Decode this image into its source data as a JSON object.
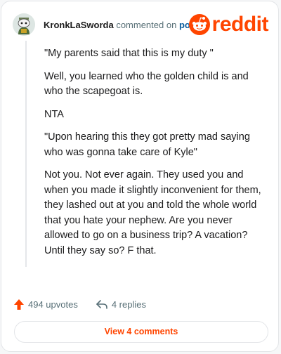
{
  "comment": {
    "username": "KronkLaSworda",
    "action_text": "commented on",
    "post_link": "post",
    "brand": "reddit",
    "brand_color": "#ff4500",
    "paragraphs": [
      "\"My parents said that this is my duty \"",
      "Well, you learned who the golden child is and who the scapegoat is.",
      "NTA",
      "\"Upon hearing this they got pretty mad saying who was gonna take care of Kyle\"",
      "Not you. Not ever again. They used you and when you made it slightly inconvenient for them, they lashed out at you and told the whole world that you hate your nephew. Are you never allowed to go on a business trip? A vacation? Until they say so? F that."
    ]
  },
  "footer": {
    "upvotes_label": "494 upvotes",
    "replies_label": "4 replies",
    "view_comments_label": "View 4 comments"
  },
  "icons": {
    "avatar": "snoo-avatar-icon",
    "logo": "reddit-snoo-icon",
    "upvote": "upvote-arrow-icon",
    "reply": "reply-arrow-icon"
  }
}
